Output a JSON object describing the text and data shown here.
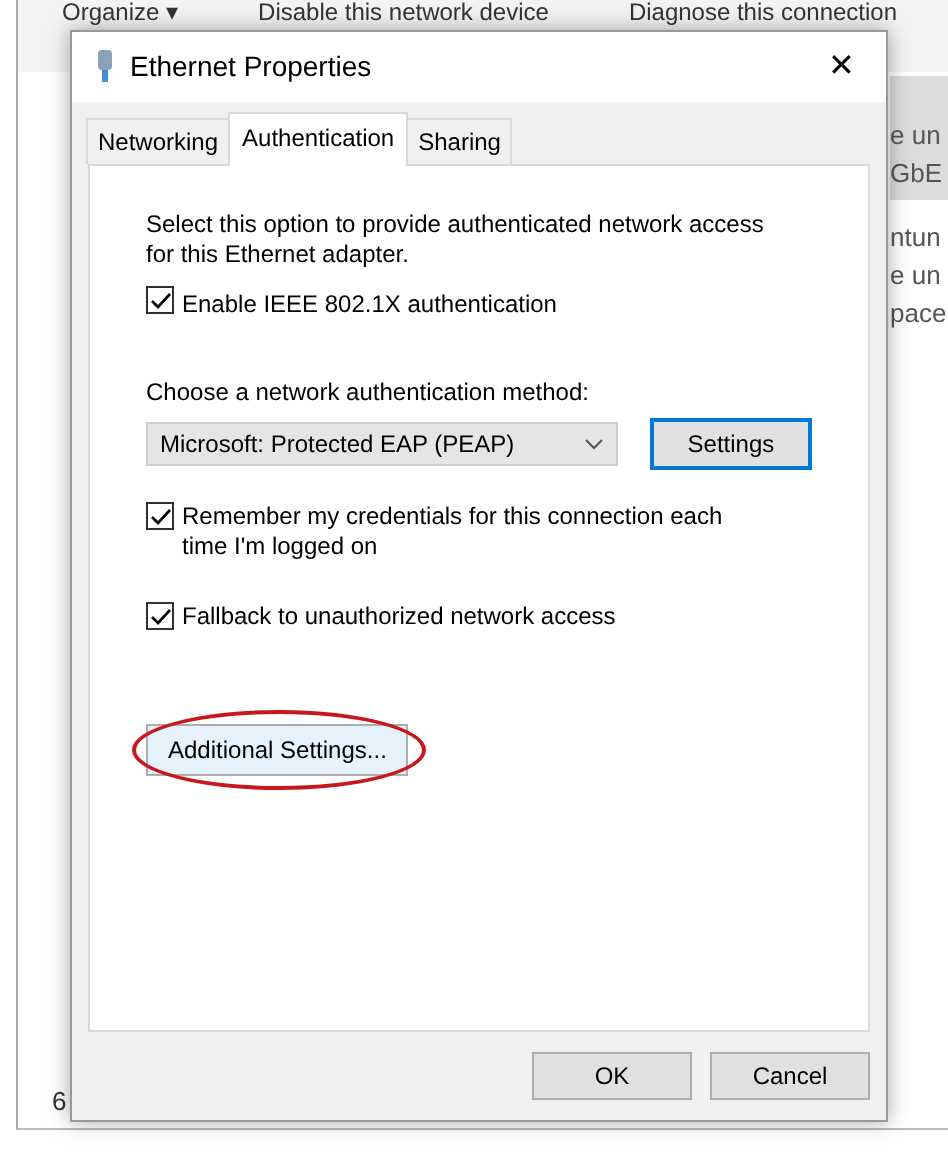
{
  "background_window": {
    "toolbar": [
      "Organize ▾",
      "Disable this network device",
      "Diagnose this connection"
    ],
    "list_items": [
      {
        "lines": [
          "e un",
          "GbE"
        ],
        "selected": true
      },
      {
        "lines": [
          "ntun",
          "e un",
          "pace"
        ],
        "selected": false
      }
    ],
    "status_bar": "6"
  },
  "dialog": {
    "title": "Ethernet Properties",
    "close": "✕",
    "tabs": [
      {
        "label": "Networking",
        "selected": false
      },
      {
        "label": "Authentication",
        "selected": true
      },
      {
        "label": "Sharing",
        "selected": false
      }
    ],
    "description": "Select this option to provide authenticated network access for this Ethernet adapter.",
    "enable_checkbox": {
      "label": "Enable IEEE 802.1X authentication",
      "checked": true
    },
    "method_label": "Choose a network authentication method:",
    "method_select": {
      "value": "Microsoft: Protected EAP (PEAP)"
    },
    "settings_button": "Settings",
    "options": [
      {
        "label": "Remember my credentials for this connection each time I'm logged on",
        "checked": true
      },
      {
        "label": "Fallback to unauthorized network access",
        "checked": true
      }
    ],
    "additional_button": {
      "label": "Additional Settings...",
      "circled": true
    },
    "buttons": [
      "OK",
      "Cancel"
    ]
  }
}
